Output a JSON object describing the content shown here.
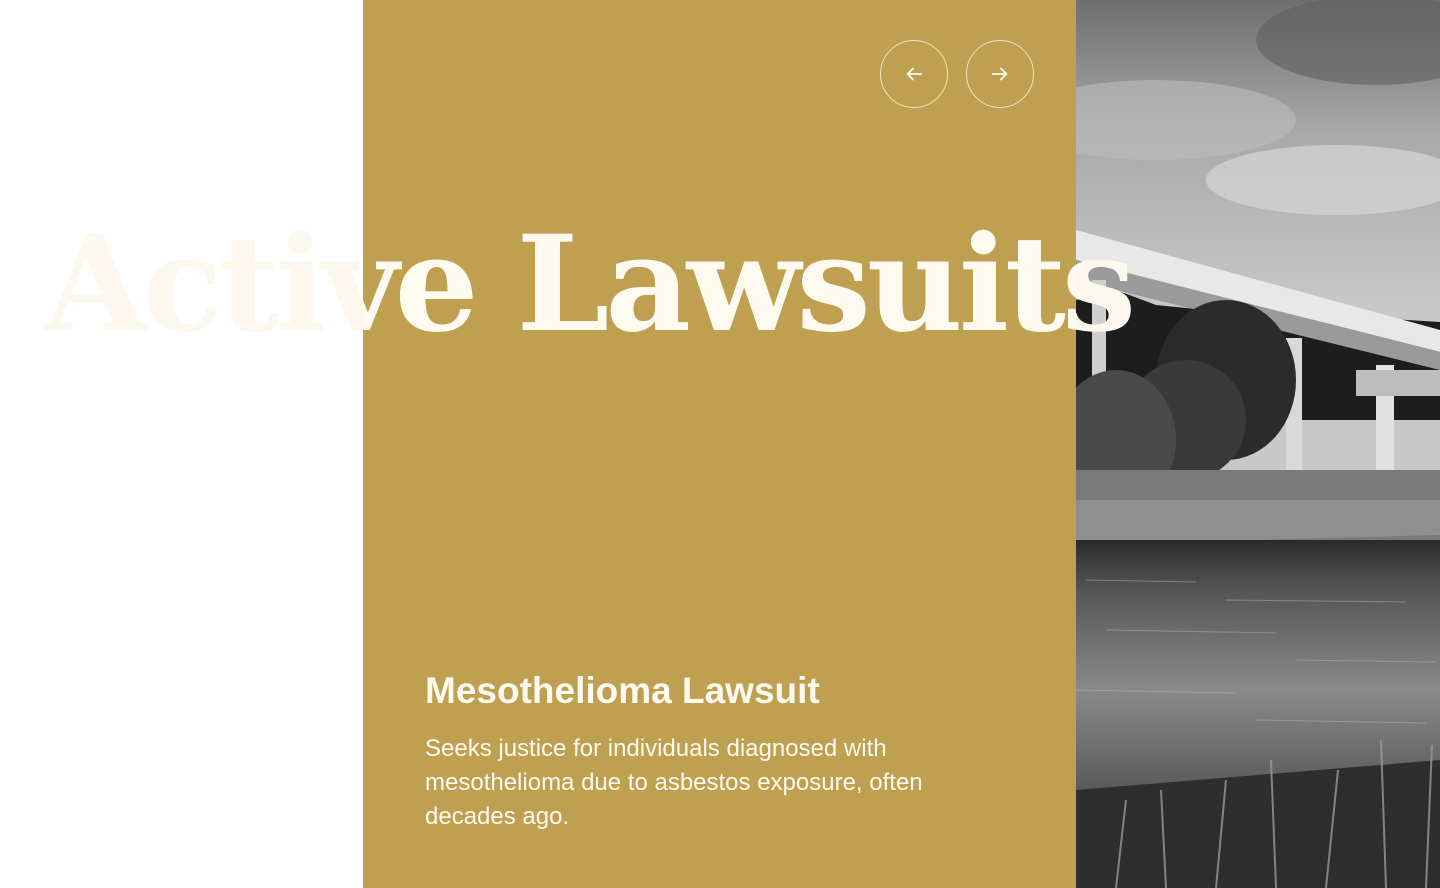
{
  "section": {
    "heading": "Active Lawsuits"
  },
  "carousel": {
    "prev_icon": "arrow-left-icon",
    "next_icon": "arrow-right-icon",
    "slide": {
      "title": "Mesothelioma Lawsuit",
      "description": "Seeks justice for individuals diagnosed with mesothelioma due to asbestos exposure, often decades ago.",
      "image": "black-and-white bridge over river with marsh grass"
    }
  },
  "colors": {
    "accent_gold": "#bf9f50",
    "cream_text": "#fffaf0",
    "ghost_text": "#fdf8ee",
    "background": "#ffffff"
  }
}
